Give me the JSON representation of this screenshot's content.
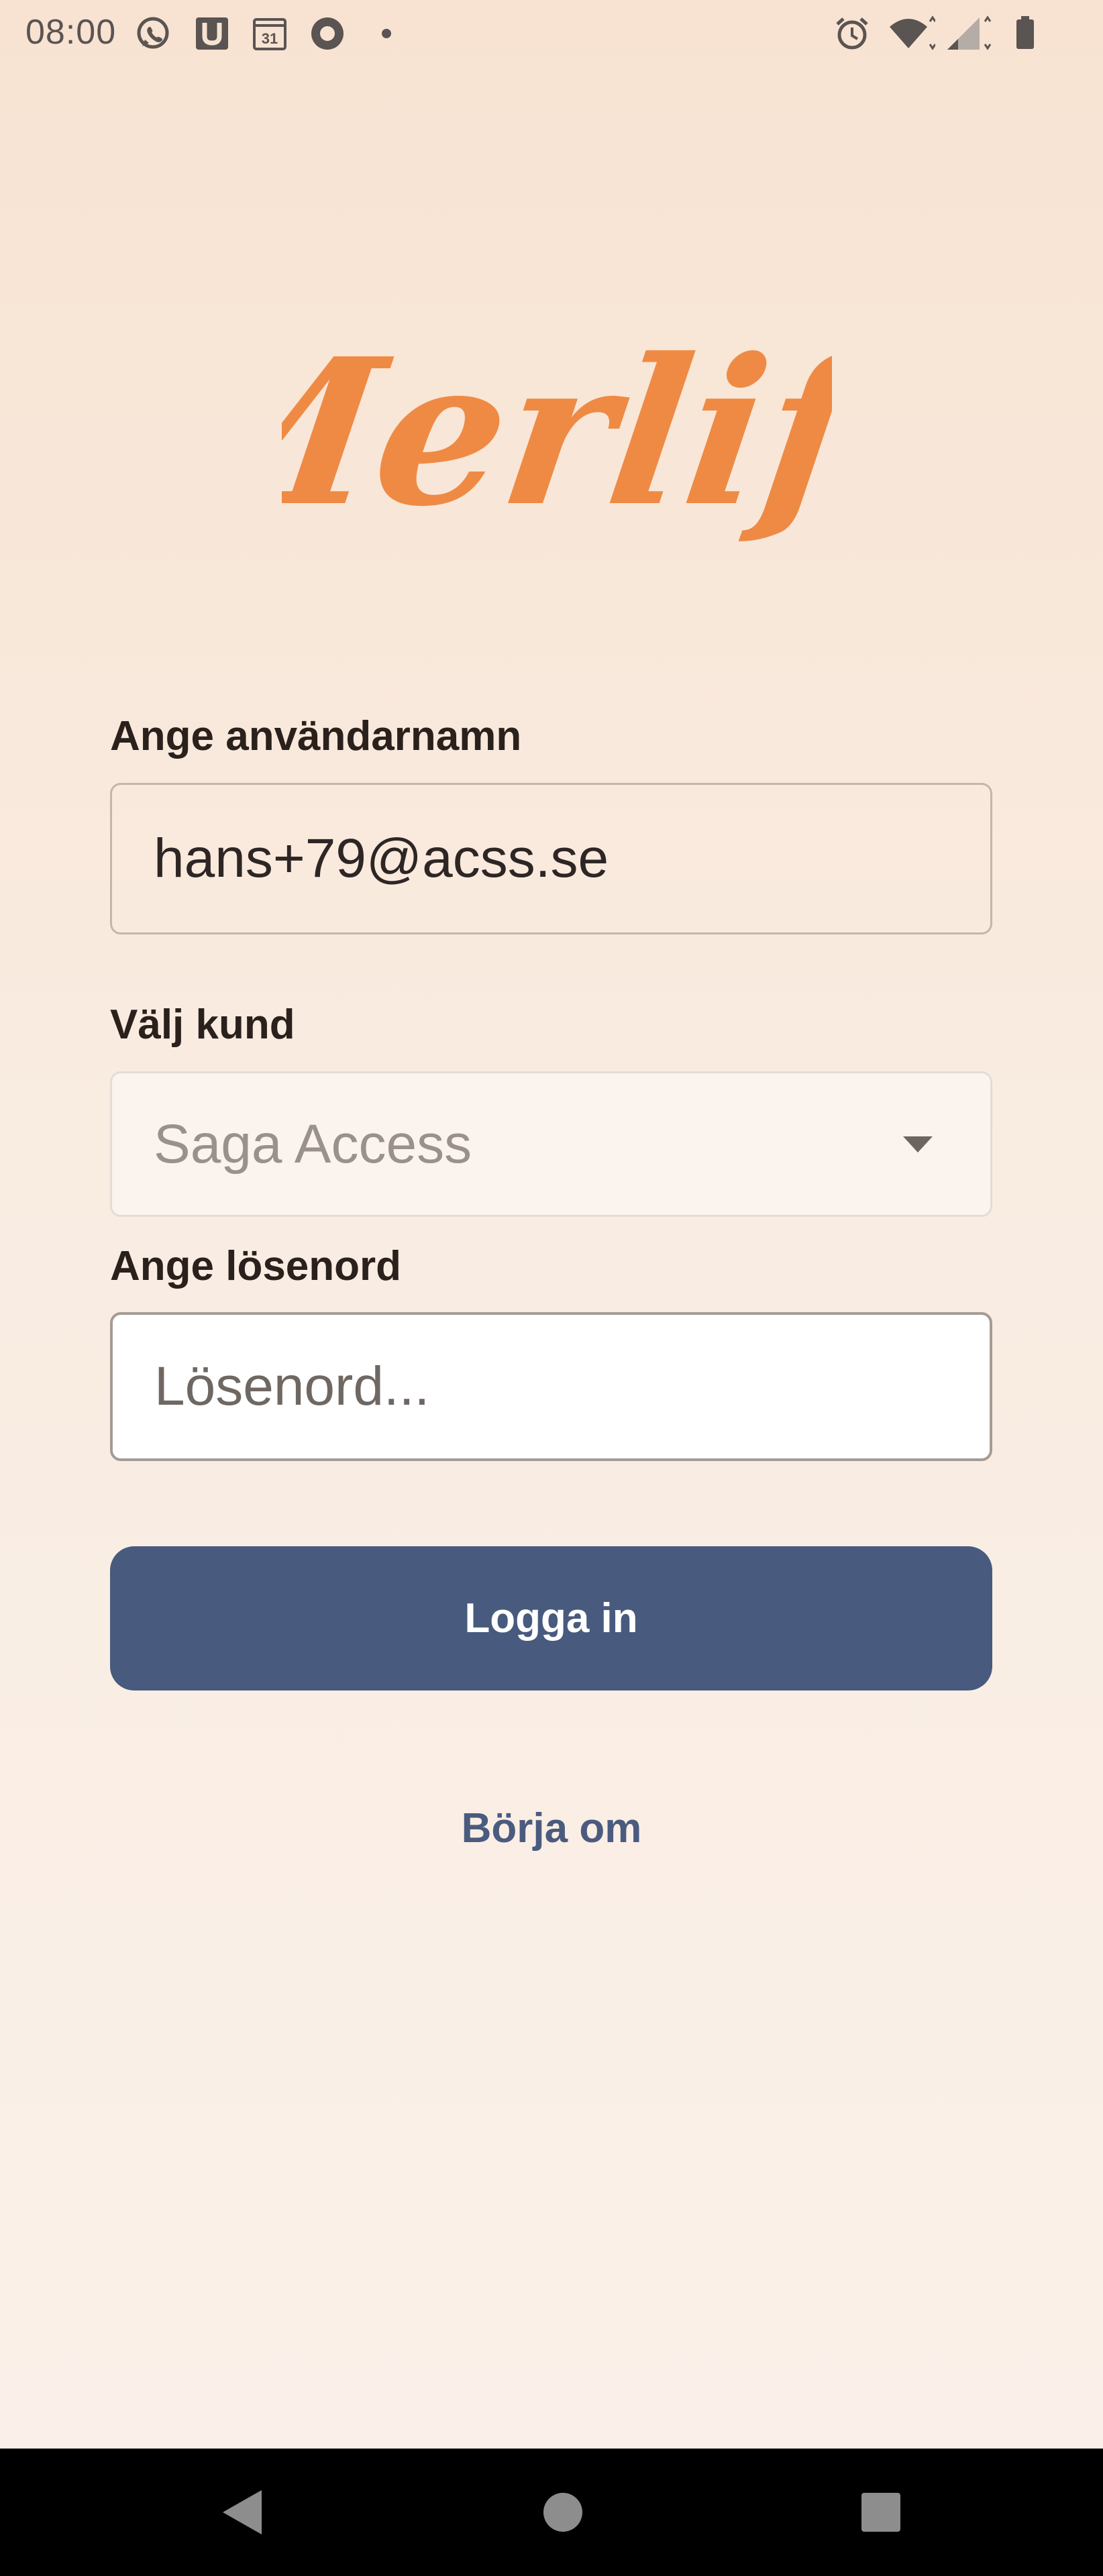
{
  "status_bar": {
    "time": "08:00",
    "calendar_day": "31",
    "icons": [
      "whatsapp-icon",
      "u-app-icon",
      "calendar-icon",
      "record-icon",
      "dot-icon",
      "alarm-icon",
      "wifi-icon",
      "signal-icon",
      "battery-icon"
    ]
  },
  "logo": {
    "text": "Merlify",
    "color": "#ef8a44"
  },
  "form": {
    "username_label": "Ange användarnamn",
    "username_value": "hans+79@acss.se",
    "customer_label": "Välj kund",
    "customer_value": "Saga Access",
    "password_label": "Ange lösenord",
    "password_placeholder": "Lösenord...",
    "password_value": ""
  },
  "actions": {
    "login_label": "Logga in",
    "restart_label": "Börja om",
    "primary_color": "#485a7e"
  },
  "nav_bar": {
    "buttons": [
      "back-icon",
      "home-icon",
      "recents-icon"
    ]
  }
}
